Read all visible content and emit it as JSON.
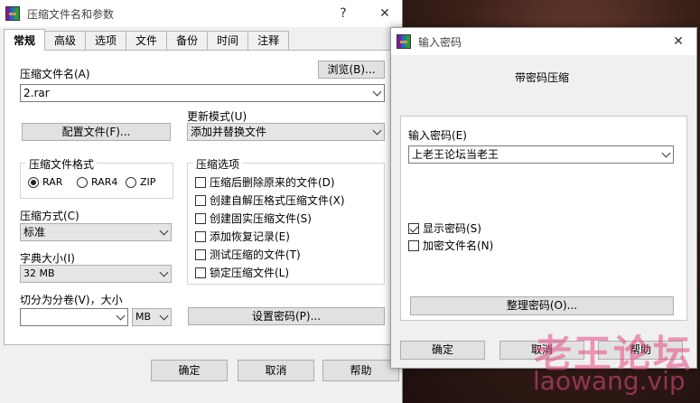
{
  "main_dialog": {
    "title": "压缩文件名和参数",
    "help_mark": "?",
    "close_glyph": "✕",
    "tabs": [
      {
        "label": "常规",
        "active": true
      },
      {
        "label": "高级"
      },
      {
        "label": "选项"
      },
      {
        "label": "文件"
      },
      {
        "label": "备份"
      },
      {
        "label": "时间"
      },
      {
        "label": "注释"
      }
    ],
    "archive_name_label": "压缩文件名(A)",
    "browse_button": "浏览(B)...",
    "archive_name_value": "2.rar",
    "profiles_button": "配置文件(F)...",
    "update_mode_label": "更新模式(U)",
    "update_mode_value": "添加并替换文件",
    "format_group": {
      "title": "压缩文件格式",
      "options": [
        {
          "label": "RAR",
          "selected": true
        },
        {
          "label": "RAR4",
          "selected": false
        },
        {
          "label": "ZIP",
          "selected": false
        }
      ]
    },
    "method_label": "压缩方式(C)",
    "method_value": "标准",
    "dict_label": "字典大小(I)",
    "dict_value": "32 MB",
    "split_label": "切分为分卷(V)，大小",
    "split_value": "",
    "split_unit": "MB",
    "options_group": {
      "title": "压缩选项",
      "items": [
        {
          "label": "压缩后删除原来的文件(D)",
          "checked": false
        },
        {
          "label": "创建自解压格式压缩文件(X)",
          "checked": false
        },
        {
          "label": "创建固实压缩文件(S)",
          "checked": false
        },
        {
          "label": "添加恢复记录(E)",
          "checked": false
        },
        {
          "label": "测试压缩的文件(T)",
          "checked": false
        },
        {
          "label": "锁定压缩文件(L)",
          "checked": false
        }
      ]
    },
    "set_password_button": "设置密码(P)...",
    "ok_button": "确定",
    "cancel_button": "取消",
    "help_button": "帮助"
  },
  "password_dialog": {
    "title": "输入密码",
    "close_glyph": "✕",
    "heading": "带密码压缩",
    "enter_password_label": "输入密码(E)",
    "password_value": "上老王论坛当老王",
    "show_password": {
      "label": "显示密码(S)",
      "checked": true
    },
    "encrypt_names": {
      "label": "加密文件名(N)",
      "checked": false
    },
    "organize_button": "整理密码(O)...",
    "ok_button": "确定",
    "cancel_button": "取消",
    "help_button": "帮助"
  },
  "watermark": {
    "line1": "老王论坛",
    "line2": "laowang.vip"
  },
  "colors": {
    "dialog_bg": "#f0f0f0",
    "button_bg": "#e1e1e1",
    "watermark": "#e84a86"
  }
}
